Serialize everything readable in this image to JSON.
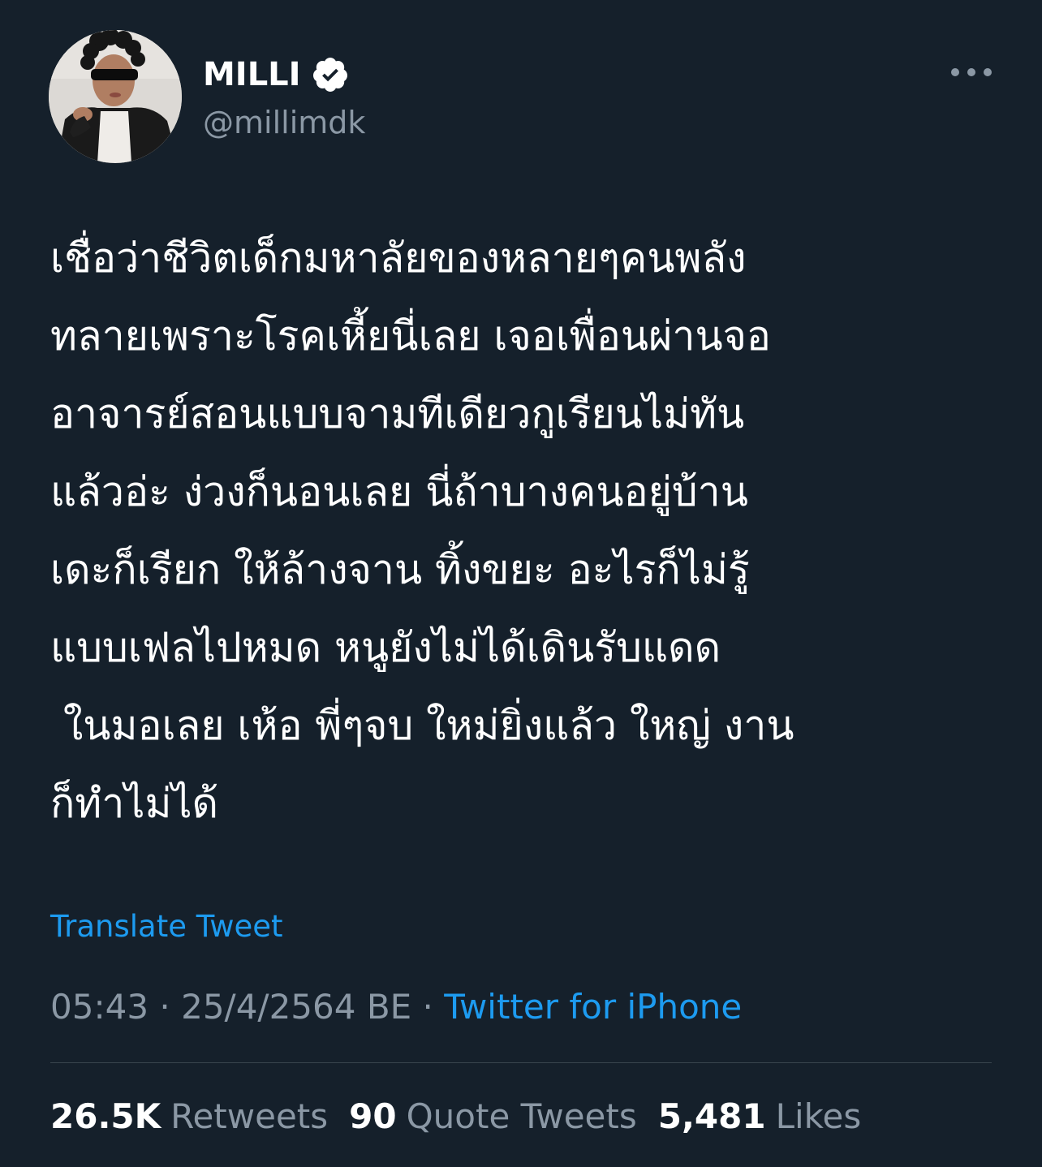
{
  "author": {
    "display_name": "MILLI",
    "handle": "@millimdk",
    "verified": true
  },
  "tweet": {
    "lines": [
      "เชื่อว่าชีวิตเด็กมหาลัยของหลายๆคนพลัง",
      "ทลายเพราะโรคเหี้ยนี่เลย เจอเพื่อนผ่านจอ",
      "อาจารย์สอนแบบจามทีเดียวกูเรียนไม่ทัน",
      "แล้วอ่ะ ง่วงก็นอนเลย นี่ถ้าบางคนอยู่บ้าน",
      "เดะก็เรียก ให้ล้างจาน ทิ้งขยะ อะไรก็ไม่รู้",
      "แบบเฟลไปหมด หนูยังไม่ได้เดินรับแดด",
      " ในมอเลย เห้อ พี่ๆจบ ใหม่ยิ่งแล้ว ใหญ่ งาน",
      "ก็ทำไม่ได้"
    ],
    "translate_label": "Translate Tweet",
    "time": "05:43",
    "date": "25/4/2564 BE",
    "separator": "·",
    "source": "Twitter for iPhone"
  },
  "stats": {
    "retweets_count": "26.5K",
    "retweets_label": "Retweets",
    "quotes_count": "90",
    "quotes_label": "Quote Tweets",
    "likes_count": "5,481",
    "likes_label": "Likes"
  },
  "colors": {
    "background": "#15202b",
    "text": "#ffffff",
    "secondary": "#8b98a5",
    "link": "#1d9bf0",
    "divider": "#38444d"
  },
  "icons": {
    "verified": "verified-badge-icon",
    "more": "more-horizontal-icon"
  }
}
